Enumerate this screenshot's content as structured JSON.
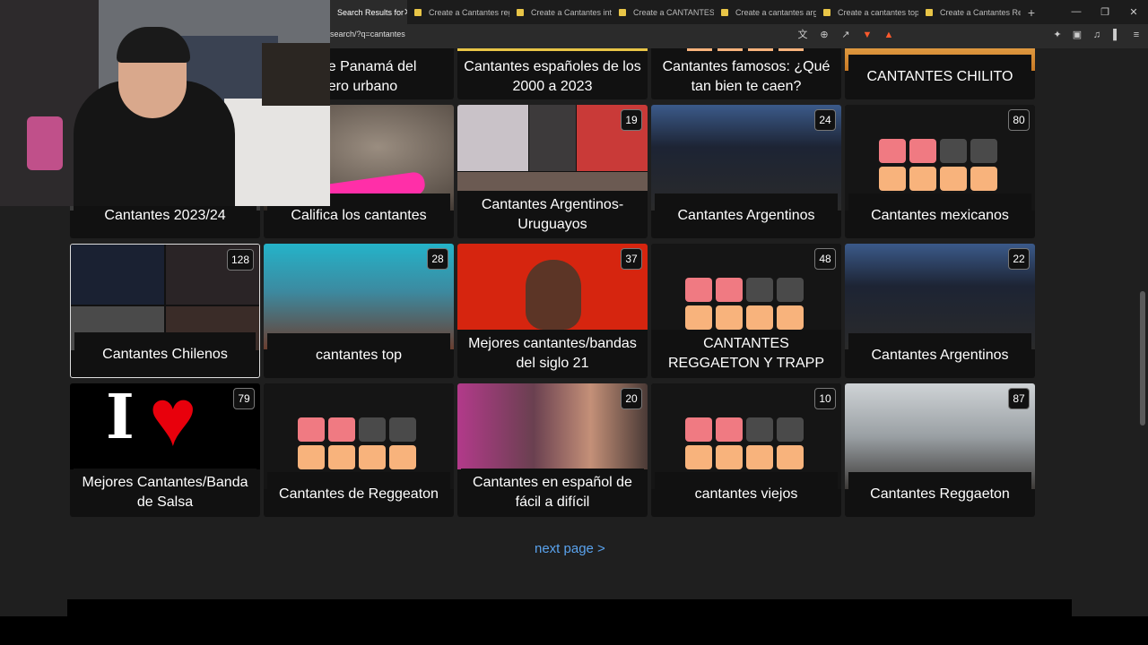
{
  "tabs": [
    {
      "label": "Search Results for",
      "active": true
    },
    {
      "label": "Create a Cantantes reg"
    },
    {
      "label": "Create a Cantantes inte"
    },
    {
      "label": "Create a CANTANTES F"
    },
    {
      "label": "Create a cantantes arg"
    },
    {
      "label": "Create a cantantes top"
    },
    {
      "label": "Create a Cantantes Re"
    }
  ],
  "address": {
    "url": "search/?q=cantantes"
  },
  "cards": [
    {
      "title": "es de Panamá del\nhero urbano",
      "count": ""
    },
    {
      "title": "Cantantes españoles de los\n2000 a 2023",
      "count": ""
    },
    {
      "title": "Cantantes famosos: ¿Qué\ntan bien te caen?",
      "count": ""
    },
    {
      "title": "CANTANTES CHILITO",
      "count": ""
    },
    {
      "title": "Cantantes 2023/24",
      "count": ""
    },
    {
      "title": "Califica los cantantes",
      "count": ""
    },
    {
      "title": "Cantantes Argentinos-\nUruguayos",
      "count": "19"
    },
    {
      "title": "Cantantes Argentinos",
      "count": "24"
    },
    {
      "title": "Cantantes mexicanos",
      "count": "80"
    },
    {
      "title": "Cantantes Chilenos",
      "count": "128"
    },
    {
      "title": "cantantes top",
      "count": "28"
    },
    {
      "title": "Mejores cantantes/bandas\ndel siglo 21",
      "count": "37"
    },
    {
      "title": "CANTANTES\nREGGAETON Y TRAPP",
      "count": "48"
    },
    {
      "title": "Cantantes Argentinos",
      "count": "22"
    },
    {
      "title": "Mejores Cantantes/Banda\nde Salsa",
      "count": "79"
    },
    {
      "title": "Cantantes de Reggeaton",
      "count": ""
    },
    {
      "title": "Cantantes en español de\nfácil a difícil",
      "count": "20"
    },
    {
      "title": "cantantes viejos",
      "count": "10"
    },
    {
      "title": "Cantantes Reggaeton",
      "count": "87"
    }
  ],
  "pagination": {
    "next_label": "next page >"
  },
  "logo_text": "I",
  "colors": {
    "link": "#5aa3ee",
    "tile_pink": "#f07a82",
    "tile_orange": "#f8b37c",
    "tile_yellow": "#f6e07a",
    "tile_grey": "#4a4a4a"
  }
}
